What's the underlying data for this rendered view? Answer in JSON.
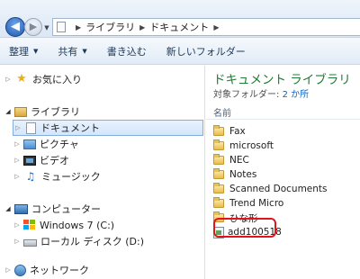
{
  "address_bar": {
    "crumbs": [
      "ライブラリ",
      "ドキュメント"
    ]
  },
  "toolbar": {
    "organize": "整理",
    "share": "共有",
    "burn": "書き込む",
    "new_folder": "新しいフォルダー"
  },
  "nav": {
    "favorites": "お気に入り",
    "libraries": "ライブラリ",
    "documents": "ドキュメント",
    "pictures": "ピクチャ",
    "videos": "ビデオ",
    "music": "ミュージック",
    "computer": "コンピューター",
    "drive_c": "Windows 7 (C:)",
    "drive_d": "ローカル ディスク (D:)",
    "network": "ネットワーク"
  },
  "content": {
    "title": "ドキュメント ライブラリ",
    "subtitle_prefix": "対象フォルダー:",
    "subtitle_link": "2 か所",
    "column_name": "名前",
    "folders": [
      "Fax",
      "microsoft",
      "NEC",
      "Notes",
      "Scanned Documents",
      "Trend Micro",
      "ひな形"
    ],
    "file": "add100518"
  },
  "colors": {
    "library_title": "#1e7b34",
    "link": "#0a64c8",
    "highlight_border": "#e1141c"
  }
}
